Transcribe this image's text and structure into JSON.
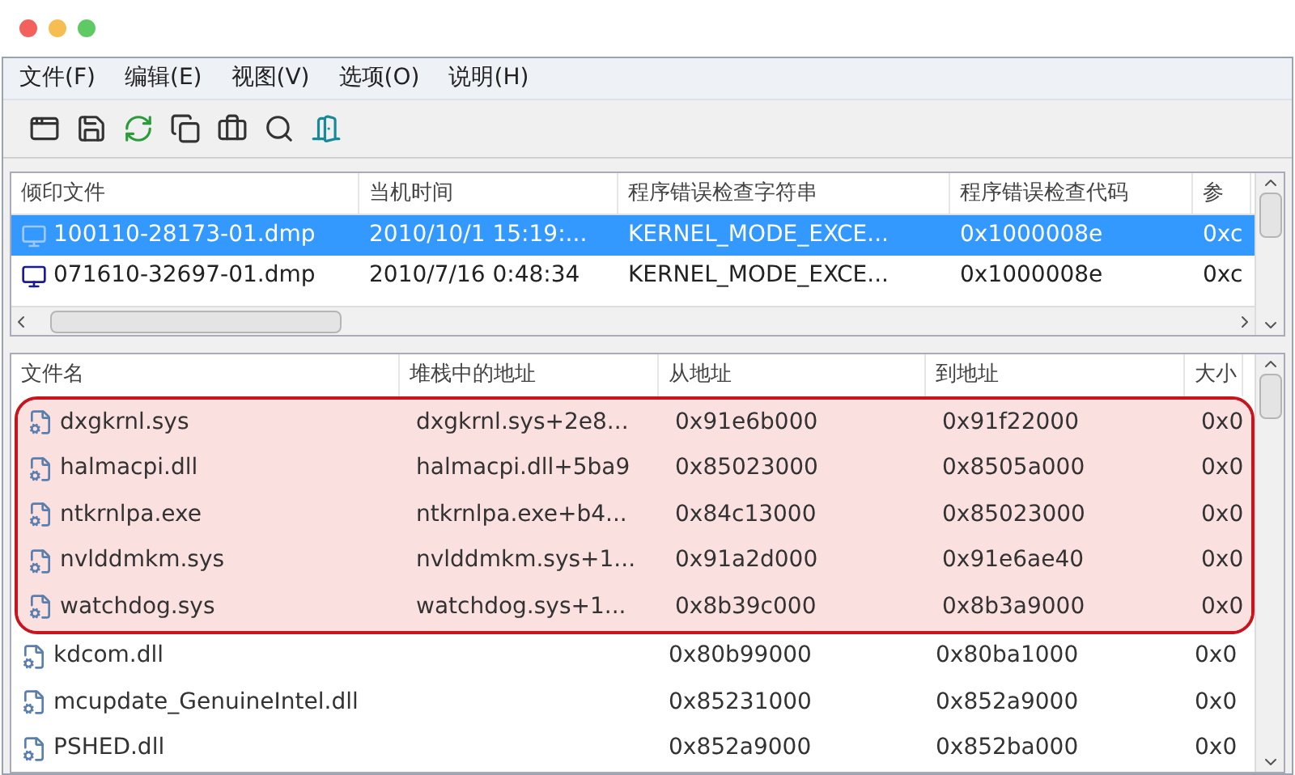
{
  "menu": [
    {
      "label": "文件(F)"
    },
    {
      "label": "编辑(E)"
    },
    {
      "label": "视图(V)"
    },
    {
      "label": "选项(O)"
    },
    {
      "label": "说明(H)"
    }
  ],
  "dump_list": {
    "columns": [
      "倾印文件",
      "当机时间",
      "程序错误检查字符串",
      "程序错误检查代码",
      "参"
    ],
    "rows": [
      {
        "selected": true,
        "cells": [
          "100110-28173-01.dmp",
          "2010/10/1 15:19:...",
          "KERNEL_MODE_EXCE...",
          "0x1000008e",
          "0xc"
        ]
      },
      {
        "selected": false,
        "cells": [
          "071610-32697-01.dmp",
          "2010/7/16 0:48:34",
          "KERNEL_MODE_EXCE...",
          "0x1000008e",
          "0xc"
        ]
      }
    ]
  },
  "driver_list": {
    "columns": [
      "文件名",
      "堆栈中的地址",
      "从地址",
      "到地址",
      "大小"
    ],
    "rows": [
      {
        "highlighted": true,
        "cells": [
          "dxgkrnl.sys",
          "dxgkrnl.sys+2e8...",
          "0x91e6b000",
          "0x91f22000",
          "0x0"
        ]
      },
      {
        "highlighted": true,
        "cells": [
          "halmacpi.dll",
          "halmacpi.dll+5ba9",
          "0x85023000",
          "0x8505a000",
          "0x0"
        ]
      },
      {
        "highlighted": true,
        "cells": [
          "ntkrnlpa.exe",
          "ntkrnlpa.exe+b4...",
          "0x84c13000",
          "0x85023000",
          "0x0"
        ]
      },
      {
        "highlighted": true,
        "cells": [
          "nvlddmkm.sys",
          "nvlddmkm.sys+1...",
          "0x91a2d000",
          "0x91e6ae40",
          "0x0"
        ]
      },
      {
        "highlighted": true,
        "cells": [
          "watchdog.sys",
          "watchdog.sys+1...",
          "0x8b39c000",
          "0x8b3a9000",
          "0x0"
        ]
      },
      {
        "highlighted": false,
        "cells": [
          "kdcom.dll",
          "",
          "0x80b99000",
          "0x80ba1000",
          "0x0"
        ]
      },
      {
        "highlighted": false,
        "cells": [
          "mcupdate_GenuineIntel.dll",
          "",
          "0x85231000",
          "0x852a9000",
          "0x0"
        ]
      },
      {
        "highlighted": false,
        "cells": [
          "PSHED.dll",
          "",
          "0x852a9000",
          "0x852ba000",
          "0x0"
        ]
      }
    ]
  }
}
